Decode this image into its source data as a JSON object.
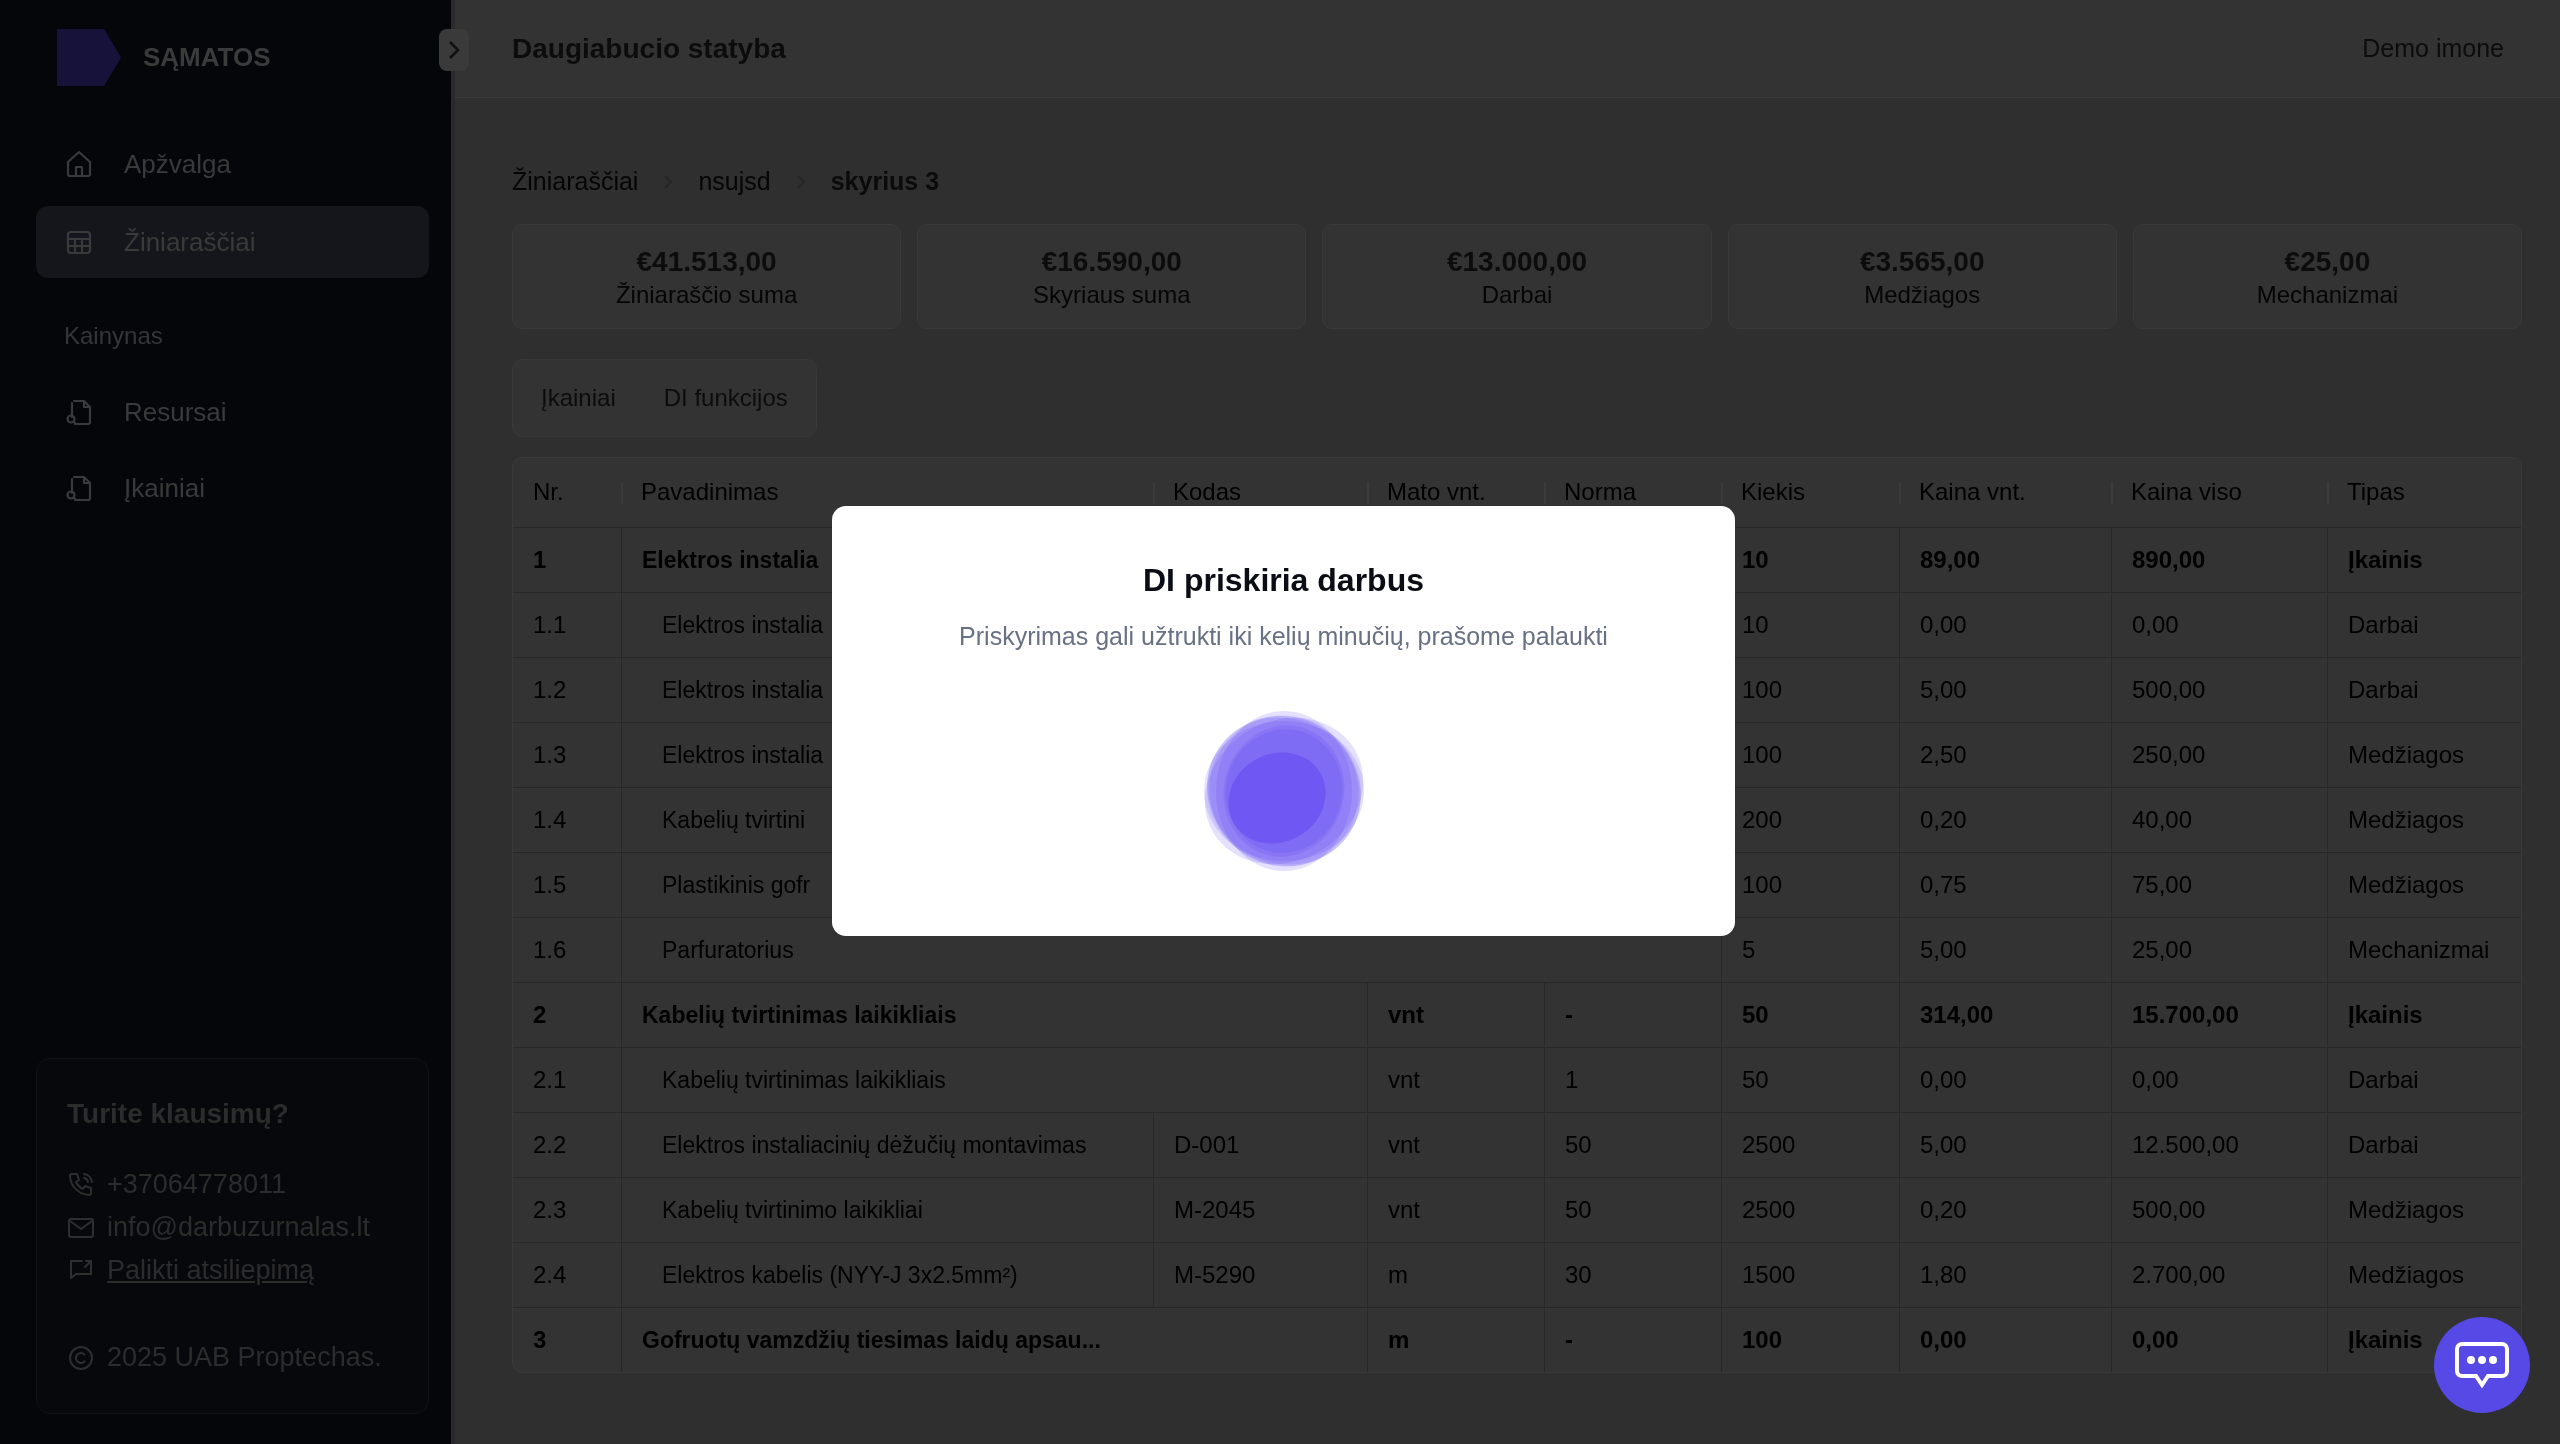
{
  "sidebar": {
    "brand": "SĄMATOS",
    "nav": [
      {
        "label": "Apžvalga",
        "selected": false
      },
      {
        "label": "Žiniaraščiai",
        "selected": true
      }
    ],
    "section_title": "Kainynas",
    "price_nav": [
      {
        "label": "Resursai",
        "selected": false
      },
      {
        "label": "Įkainiai",
        "selected": false
      }
    ],
    "help": {
      "title": "Turite klausimų?",
      "phone": "+37064778011",
      "email": "info@darbuzurnalas.lt",
      "feedback_link": "Palikti atsiliepimą",
      "copyright": "2025 UAB Proptechas."
    }
  },
  "header": {
    "title": "Daugiabucio statyba",
    "company": "Demo imone"
  },
  "breadcrumb": [
    {
      "label": "Žiniaraščiai",
      "current": false
    },
    {
      "label": "nsujsd",
      "current": false
    },
    {
      "label": "skyrius 3",
      "current": true
    }
  ],
  "summary": [
    {
      "value": "€41.513,00",
      "label": "Žiniaraščio suma"
    },
    {
      "value": "€16.590,00",
      "label": "Skyriaus suma"
    },
    {
      "value": "€13.000,00",
      "label": "Darbai"
    },
    {
      "value": "€3.565,00",
      "label": "Medžiagos"
    },
    {
      "value": "€25,00",
      "label": "Mechanizmai"
    }
  ],
  "tabs": [
    {
      "label": "Įkainiai"
    },
    {
      "label": "DI funkcijos"
    }
  ],
  "table": {
    "columns": [
      "Nr.",
      "Pavadinimas",
      "Kodas",
      "Mato vnt.",
      "Norma",
      "Kiekis",
      "Kaina vnt.",
      "Kaina viso",
      "Tipas"
    ],
    "rows": [
      {
        "kind": "group",
        "nr": "1",
        "name": "Elektros instalia",
        "qty": "10",
        "unit_price": "89,00",
        "total": "890,00",
        "type": "Įkainis"
      },
      {
        "kind": "item",
        "nr": "1.1",
        "name": "Elektros instalia",
        "qty": "10",
        "unit_price": "0,00",
        "total": "0,00",
        "type": "Darbai"
      },
      {
        "kind": "item",
        "nr": "1.2",
        "name": "Elektros instalia",
        "qty": "100",
        "unit_price": "5,00",
        "total": "500,00",
        "type": "Darbai"
      },
      {
        "kind": "item",
        "nr": "1.3",
        "name": "Elektros instalia",
        "qty": "100",
        "unit_price": "2,50",
        "total": "250,00",
        "type": "Medžiagos"
      },
      {
        "kind": "item",
        "nr": "1.4",
        "name": "Kabelių tvirtini",
        "qty": "200",
        "unit_price": "0,20",
        "total": "40,00",
        "type": "Medžiagos"
      },
      {
        "kind": "item",
        "nr": "1.5",
        "name": "Plastikinis gofr",
        "qty": "100",
        "unit_price": "0,75",
        "total": "75,00",
        "type": "Medžiagos"
      },
      {
        "kind": "item",
        "nr": "1.6",
        "name": "Parfuratorius",
        "qty": "5",
        "unit_price": "5,00",
        "total": "25,00",
        "type": "Mechanizmai"
      },
      {
        "kind": "group",
        "nr": "2",
        "name": "Kabelių tvirtinimas laikikliais",
        "code": "",
        "unit": "vnt",
        "norm": "-",
        "qty": "50",
        "unit_price": "314,00",
        "total": "15.700,00",
        "type": "Įkainis"
      },
      {
        "kind": "item",
        "nr": "2.1",
        "name": "Kabelių tvirtinimas laikikliais",
        "unit": "vnt",
        "norm": "1",
        "qty": "50",
        "unit_price": "0,00",
        "total": "0,00",
        "type": "Darbai"
      },
      {
        "kind": "item",
        "nr": "2.2",
        "name": "Elektros instaliacinių dėžučių montavimas",
        "code": "D-001",
        "unit": "vnt",
        "norm": "50",
        "qty": "2500",
        "unit_price": "5,00",
        "total": "12.500,00",
        "type": "Darbai"
      },
      {
        "kind": "item",
        "nr": "2.3",
        "name": "Kabelių tvirtinimo laikikliai",
        "code": "M-2045",
        "unit": "vnt",
        "norm": "50",
        "qty": "2500",
        "unit_price": "0,20",
        "total": "500,00",
        "type": "Medžiagos"
      },
      {
        "kind": "item",
        "nr": "2.4",
        "name": "Elektros kabelis (NYY-J 3x2.5mm²)",
        "code": "M-5290",
        "unit": "m",
        "norm": "30",
        "qty": "1500",
        "unit_price": "1,80",
        "total": "2.700,00",
        "type": "Medžiagos"
      },
      {
        "kind": "group",
        "nr": "3",
        "name": "Gofruotų vamzdžių tiesimas laidų apsau...",
        "unit": "m",
        "norm": "-",
        "qty": "100",
        "unit_price": "0,00",
        "total": "0,00",
        "type": "Įkainis"
      }
    ]
  },
  "modal": {
    "title": "DI priskiria darbus",
    "message": "Priskyrimas gali užtrukti iki kelių minučių, prašome palaukti"
  }
}
